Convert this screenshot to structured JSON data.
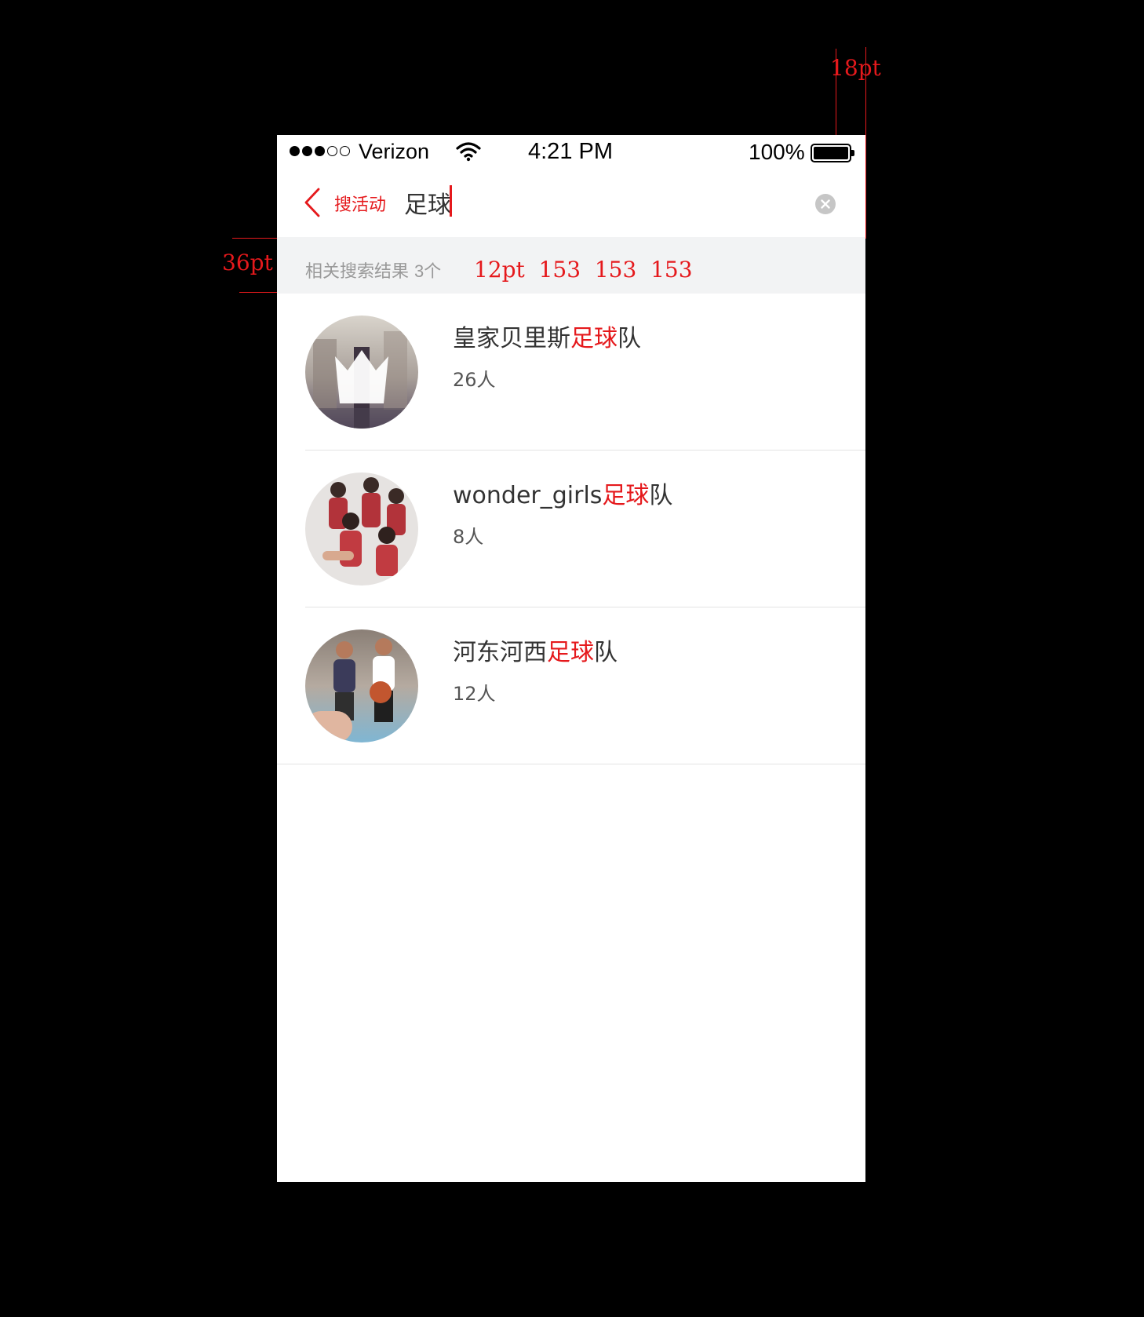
{
  "annotations": {
    "top_right_spacing": "18pt",
    "left_spacing": "36pt",
    "font_spec": "12pt  153  153  153"
  },
  "status_bar": {
    "carrier": "Verizon",
    "time": "4:21 PM",
    "battery": "100%"
  },
  "nav": {
    "title": "搜活动",
    "search_value": "足球"
  },
  "results": {
    "label": "相关搜索结果",
    "count": "3个"
  },
  "items": [
    {
      "name_prefix": "皇家贝里斯",
      "name_highlight": "足球",
      "name_suffix": "队",
      "members": "26人"
    },
    {
      "name_prefix": "wonder_girls",
      "name_highlight": "足球",
      "name_suffix": "队",
      "members": "8人"
    },
    {
      "name_prefix": "河东河西",
      "name_highlight": "足球",
      "name_suffix": "队",
      "members": "12人"
    }
  ],
  "colors": {
    "accent": "#e5191c",
    "result_bar_bg": "#f2f3f4",
    "result_text": "#999999"
  },
  "icons": [
    "wifi-icon",
    "battery-icon",
    "back-arrow-icon",
    "clear-icon"
  ]
}
